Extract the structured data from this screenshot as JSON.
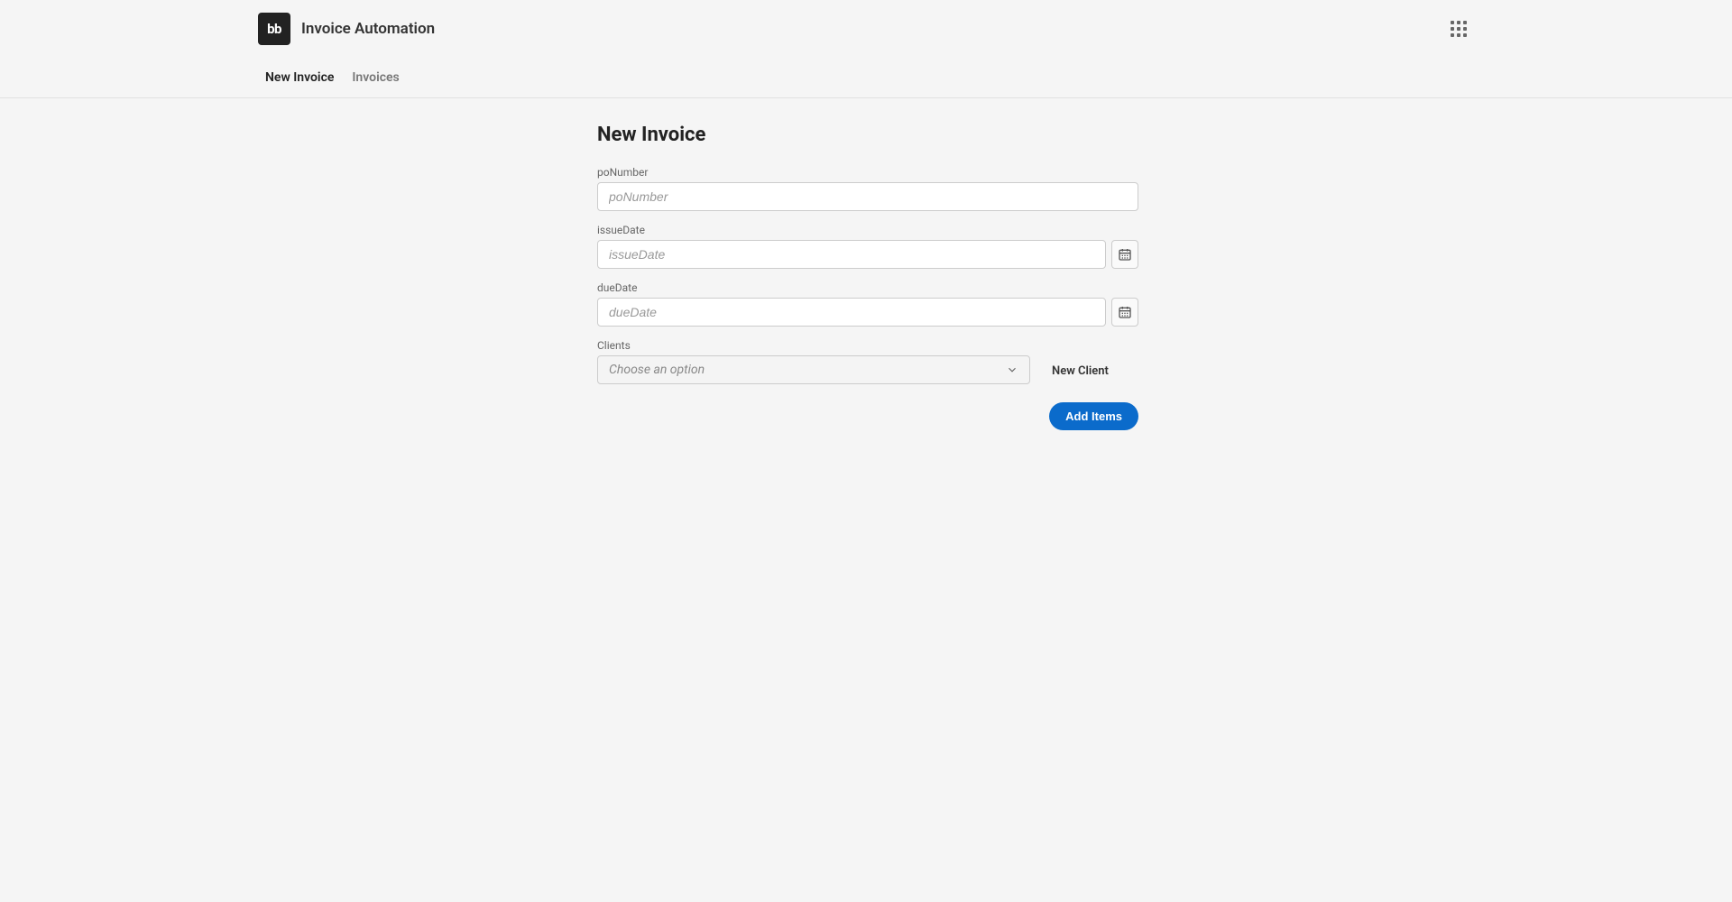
{
  "brand": {
    "logo_text": "bb",
    "title": "Invoice Automation"
  },
  "tabs": [
    {
      "label": "New Invoice",
      "active": true
    },
    {
      "label": "Invoices",
      "active": false
    }
  ],
  "page": {
    "title": "New Invoice"
  },
  "form": {
    "poNumber": {
      "label": "poNumber",
      "placeholder": "poNumber",
      "value": ""
    },
    "issueDate": {
      "label": "issueDate",
      "placeholder": "issueDate",
      "value": ""
    },
    "dueDate": {
      "label": "dueDate",
      "placeholder": "dueDate",
      "value": ""
    },
    "clients": {
      "label": "Clients",
      "placeholder": "Choose an option",
      "selected": ""
    },
    "newClient_label": "New Client",
    "addItems_label": "Add Items"
  }
}
